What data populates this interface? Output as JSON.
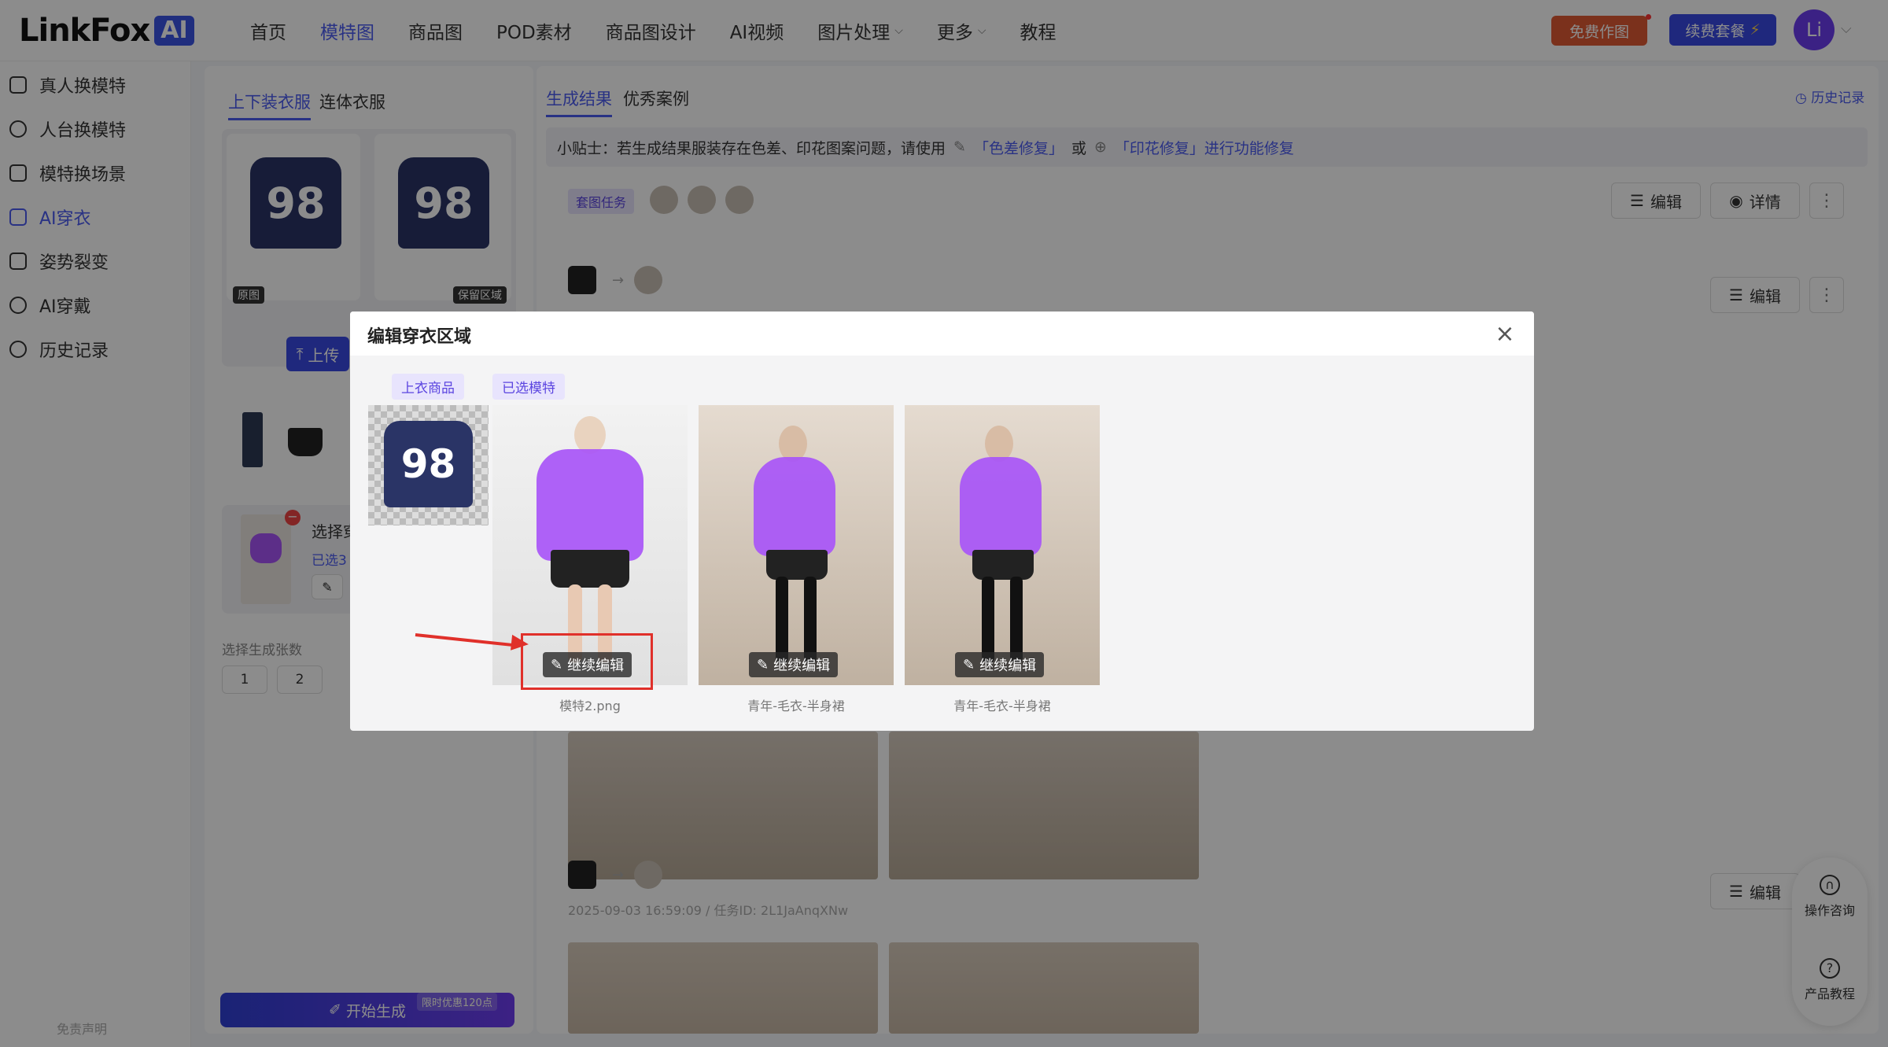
{
  "header": {
    "logo_text": "LinkFox",
    "logo_badge": "AI",
    "nav": [
      {
        "label": "首页"
      },
      {
        "label": "模特图"
      },
      {
        "label": "商品图"
      },
      {
        "label": "POD素材"
      },
      {
        "label": "商品图设计"
      },
      {
        "label": "AI视频"
      },
      {
        "label": "图片处理"
      },
      {
        "label": "更多"
      },
      {
        "label": "教程"
      }
    ],
    "active_nav": "模特图",
    "free_button": "免费作图",
    "renew_button": "续费套餐",
    "renew_icon": "⚡",
    "avatar_text": "Li"
  },
  "sidebar": {
    "items": [
      {
        "label": "真人换模特",
        "icon": "person-swap-icon"
      },
      {
        "label": "人台换模特",
        "icon": "mannequin-icon"
      },
      {
        "label": "模特换场景",
        "icon": "scene-icon"
      },
      {
        "label": "AI穿衣",
        "icon": "shirt-icon"
      },
      {
        "label": "姿势裂变",
        "icon": "pose-icon"
      },
      {
        "label": "AI穿戴",
        "icon": "wear-icon"
      },
      {
        "label": "历史记录",
        "icon": "history-icon"
      }
    ],
    "active": "AI穿衣",
    "disclaimer": "免责声明"
  },
  "config": {
    "tabs": [
      "上下装衣服",
      "连体衣服"
    ],
    "garment_tags": [
      "原图",
      "保留区域"
    ],
    "upload_label": "上传",
    "model_select_label": "选择穿",
    "model_selected_count": "已选3",
    "gen_count_label": "选择生成张数",
    "gen_counts": [
      "1",
      "2"
    ],
    "start_button": "开始生成",
    "start_promo": "限时优惠120点"
  },
  "results": {
    "tabs": [
      "生成结果",
      "优秀案例"
    ],
    "history_link": "历史记录",
    "tip_prefix": "小贴士：若生成结果服装存在色差、印花图案问题，请使用",
    "tip_link1": "「色差修复」",
    "tip_or": "或",
    "tip_link2": "「印花修复」进行功能修复",
    "task_badge": "套图任务",
    "edit_label": "编辑",
    "detail_label": "详情",
    "task2_meta": "2025-09-03 16:59:09 / 任务ID: 2L1JaAnqXNw"
  },
  "modal": {
    "title": "编辑穿衣区域",
    "tag_top": "上衣商品",
    "tag_model": "已选模特",
    "continue_edit": "继续编辑",
    "captions": [
      "模特2.png",
      "青年-毛衣-半身裙",
      "青年-毛衣-半身裙"
    ]
  },
  "help": {
    "consult": "操作咨询",
    "tutorial": "产品教程"
  },
  "colors": {
    "accent": "#4c5bf0",
    "highlight": "#e0302a",
    "mask_purple": "#a855f7"
  }
}
